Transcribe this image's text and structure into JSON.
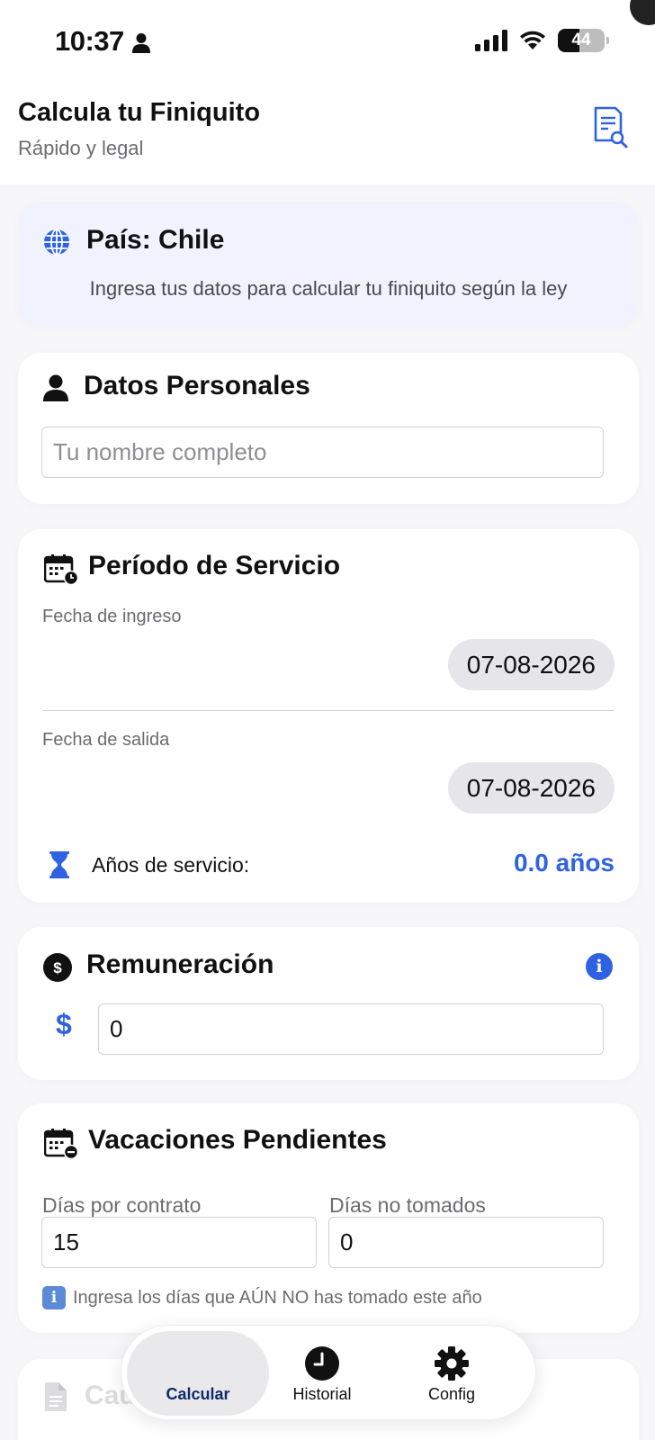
{
  "status_bar": {
    "time": "10:37",
    "battery": "44"
  },
  "header": {
    "title": "Calcula tu Finiquito",
    "subtitle": "Rápido y legal"
  },
  "country": {
    "title": "País: Chile",
    "description": "Ingresa tus datos para calcular tu finiquito según la ley"
  },
  "personal": {
    "title": "Datos Personales",
    "name_placeholder": "Tu nombre completo"
  },
  "period": {
    "title": "Período de Servicio",
    "start_label": "Fecha de ingreso",
    "start_date": "07-08-2026",
    "end_label": "Fecha de salida",
    "end_date": "07-08-2026",
    "years_label": "Años de servicio:",
    "years_value": "0.0 años"
  },
  "salary": {
    "title": "Remuneración",
    "currency": "$",
    "value": "0"
  },
  "vacation": {
    "title": "Vacaciones Pendientes",
    "contract_label": "Días por contrato",
    "contract_value": "15",
    "untaken_label": "Días no tomados",
    "untaken_value": "0",
    "hint_icon": "i",
    "hint": "Ingresa los días que AÚN NO has tomado este año"
  },
  "peek": {
    "title": "Cau"
  },
  "tabs": [
    {
      "label": "Calcular",
      "icon": "calculator-icon",
      "active": true
    },
    {
      "label": "Historial",
      "icon": "clock-icon",
      "active": false
    },
    {
      "label": "Config",
      "icon": "gear-icon",
      "active": false
    }
  ],
  "colors": {
    "accent": "#2f62e2",
    "country_bg": "#f0f2fd",
    "pill_bg": "#e5e5ea"
  }
}
